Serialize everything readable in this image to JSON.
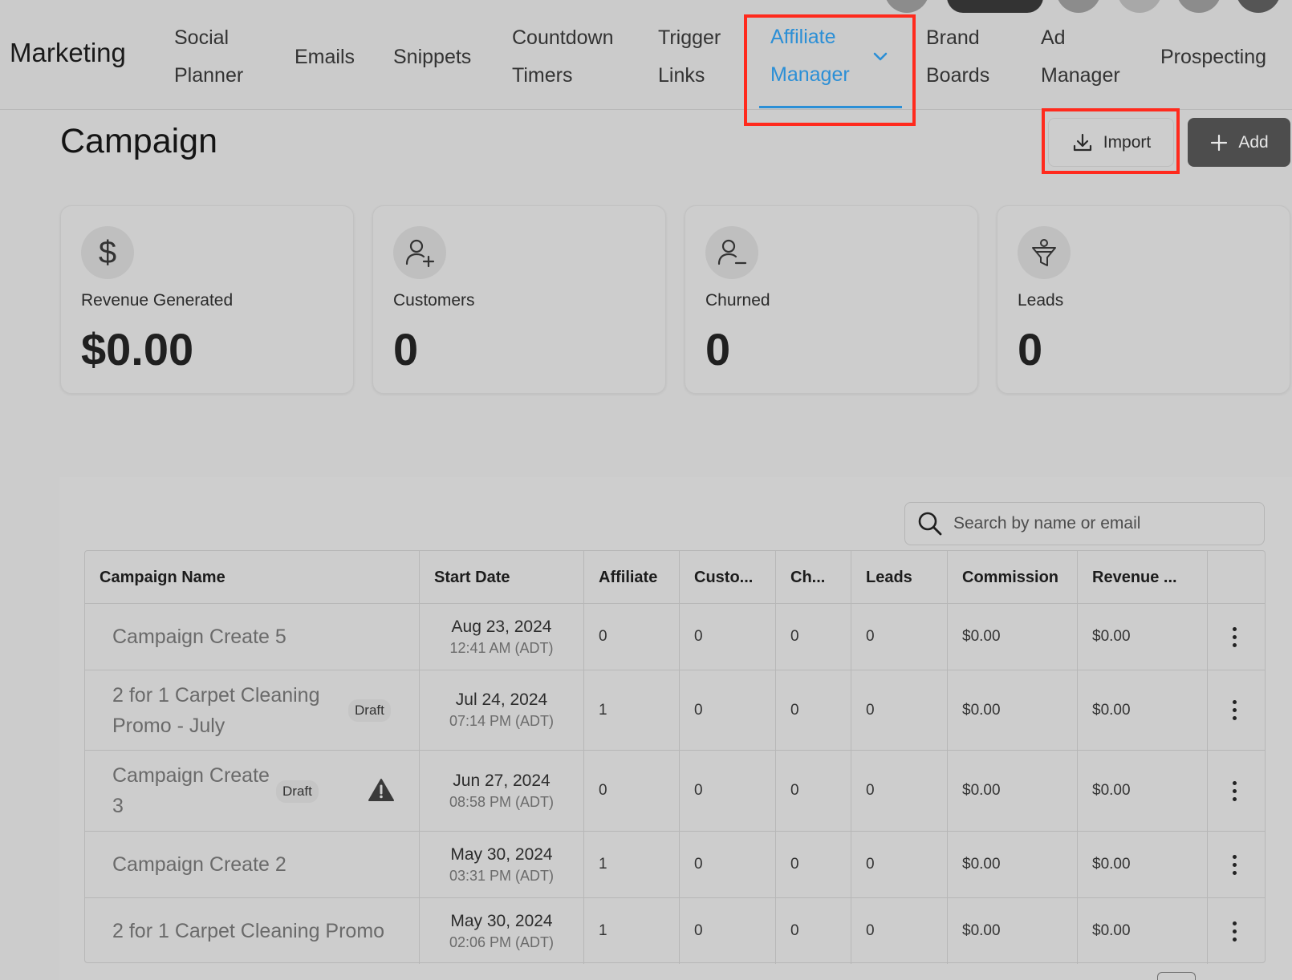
{
  "nav": {
    "brand": "Marketing",
    "items": [
      {
        "line1": "Social",
        "line2": "Planner"
      },
      {
        "line1": "Emails"
      },
      {
        "line1": "Snippets"
      },
      {
        "line1": "Countdown",
        "line2": "Timers"
      },
      {
        "line1": "Trigger",
        "line2": "Links"
      },
      {
        "line1": "Affiliate",
        "line2": "Manager",
        "active": true
      },
      {
        "line1": "Brand",
        "line2": "Boards"
      },
      {
        "line1": "Ad",
        "line2": "Manager"
      },
      {
        "line1": "Prospecting"
      }
    ],
    "accent_color": "#2b8fd6"
  },
  "header": {
    "title": "Campaign",
    "import_label": "Import",
    "add_label": "Add"
  },
  "stats": [
    {
      "icon": "dollar-icon",
      "label": "Revenue Generated",
      "value": "$0.00"
    },
    {
      "icon": "user-plus-icon",
      "label": "Customers",
      "value": "0"
    },
    {
      "icon": "user-minus-icon",
      "label": "Churned",
      "value": "0"
    },
    {
      "icon": "funnel-icon",
      "label": "Leads",
      "value": "0"
    }
  ],
  "search": {
    "placeholder": "Search by name or email"
  },
  "table": {
    "columns": [
      "Campaign Name",
      "Start Date",
      "Affiliate",
      "Custo...",
      "Ch...",
      "Leads",
      "Commission",
      "Revenue ..."
    ],
    "rows": [
      {
        "name": "Campaign Create 5",
        "date": "Aug 23, 2024",
        "time": "12:41 AM (ADT)",
        "affiliate": "0",
        "customers": "0",
        "churned": "0",
        "leads": "0",
        "commission": "$0.00",
        "revenue": "$0.00"
      },
      {
        "name": "2 for 1 Carpet Cleaning Promo - July",
        "draft": "Draft",
        "date": "Jul 24, 2024",
        "time": "07:14 PM (ADT)",
        "affiliate": "1",
        "customers": "0",
        "churned": "0",
        "leads": "0",
        "commission": "$0.00",
        "revenue": "$0.00"
      },
      {
        "name": "Campaign Create 3",
        "draft": "Draft",
        "warning": true,
        "date": "Jun 27, 2024",
        "time": "08:58 PM (ADT)",
        "affiliate": "0",
        "customers": "0",
        "churned": "0",
        "leads": "0",
        "commission": "$0.00",
        "revenue": "$0.00"
      },
      {
        "name": "Campaign Create 2",
        "date": "May 30, 2024",
        "time": "03:31 PM (ADT)",
        "affiliate": "1",
        "customers": "0",
        "churned": "0",
        "leads": "0",
        "commission": "$0.00",
        "revenue": "$0.00"
      },
      {
        "name": "2 for 1 Carpet Cleaning Promo",
        "date": "May 30, 2024",
        "time": "02:06 PM (ADT)",
        "affiliate": "1",
        "customers": "0",
        "churned": "0",
        "leads": "0",
        "commission": "$0.00",
        "revenue": "$0.00"
      }
    ]
  }
}
